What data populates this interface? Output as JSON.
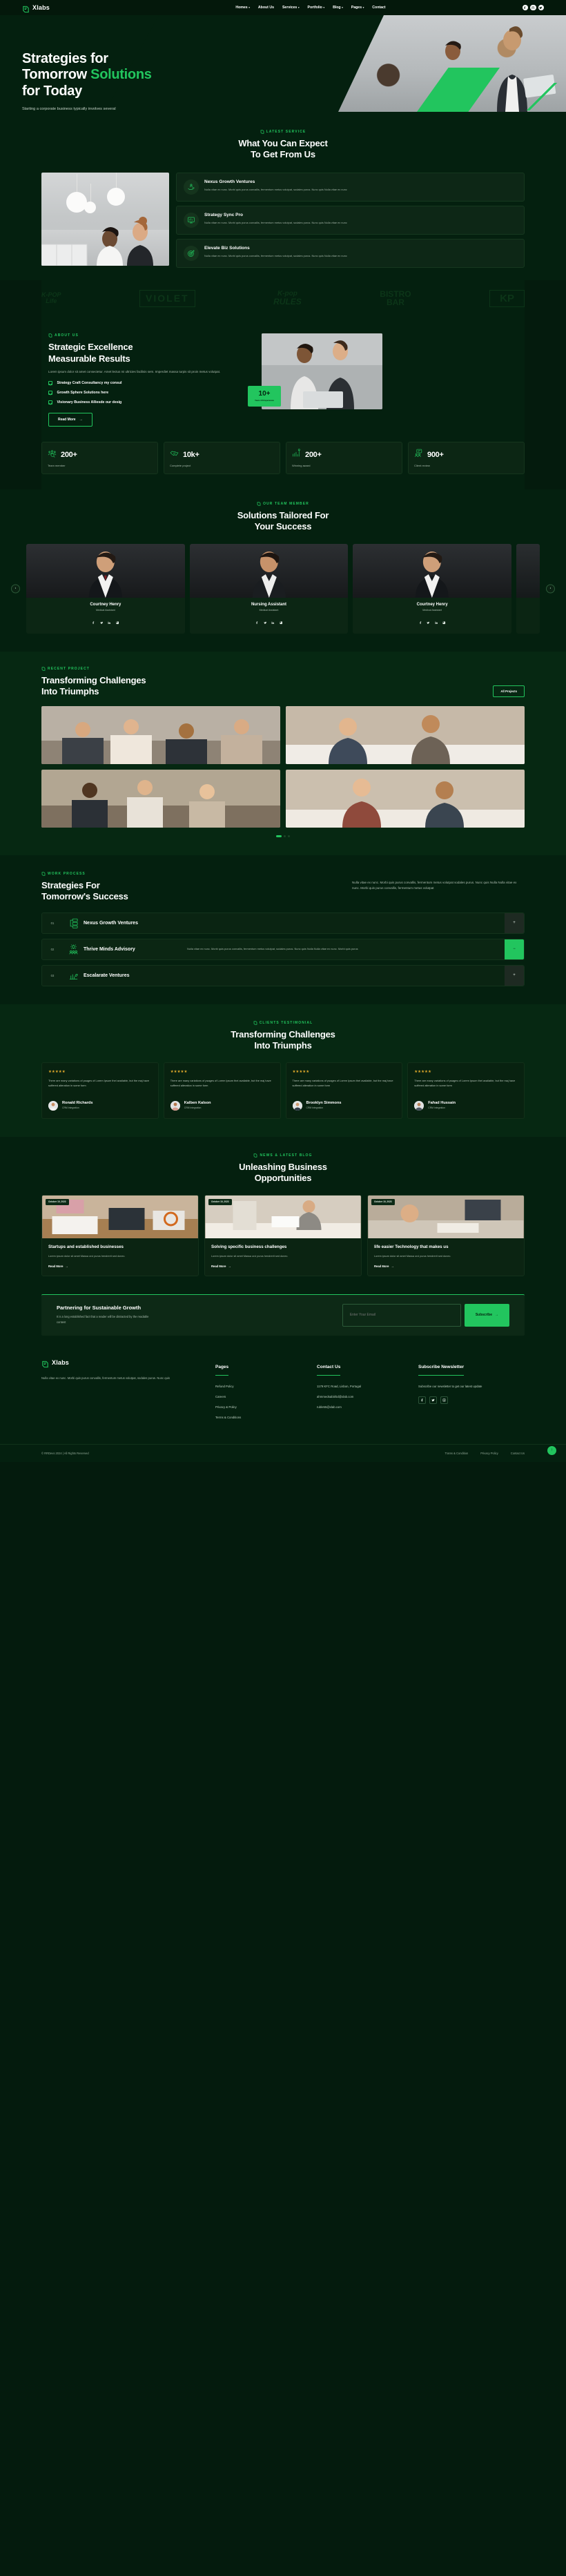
{
  "brand": {
    "name": "Xlabs",
    "logo_icon": "xlabs-logo-icon",
    "accent": "#22c55e",
    "bg": "#04200f"
  },
  "header": {
    "nav": [
      {
        "label": "Homes",
        "caret": "▾"
      },
      {
        "label": "About Us",
        "caret": ""
      },
      {
        "label": "Services",
        "caret": "▾"
      },
      {
        "label": "Portfolio",
        "caret": "▾"
      },
      {
        "label": "Blog",
        "caret": "▾"
      },
      {
        "label": "Pages",
        "caret": "▾"
      },
      {
        "label": "Contact",
        "caret": ""
      }
    ],
    "socials": [
      "facebook-icon",
      "instagram-icon",
      "twitter-icon"
    ]
  },
  "hero": {
    "title_line1": "Strategies for",
    "title_line2a": "Tomorrow ",
    "title_line2b": "Solutions",
    "title_line3": "for Today",
    "subtitle": "Starting a corporate business typically involves several steps, such as decide a business"
  },
  "expect": {
    "eyebrow": "LATEST SERVICE",
    "title_line1": "What You Can Expect",
    "title_line2": "To Get From Us",
    "services": [
      {
        "icon": "hand-person-icon",
        "title": "Nexus Growth Ventures",
        "text": "Nulla vitae ex nunc. Morbi quis purus convallis, fermentum metus volutpat, sodales purus. Nunc quis Nulla vitae ex nunc"
      },
      {
        "icon": "monitor-chart-icon",
        "title": "Strategy Sync Pro",
        "text": "Nulla vitae ex nunc. Morbi quis purus convallis, fermentum metus volutpat, sodales purus. Nunc quis Nulla vitae ex nunc"
      },
      {
        "icon": "target-dart-icon",
        "title": "Elevate Biz Solutions",
        "text": "Nulla vitae ex nunc. Morbi quis purus convallis, fermentum metus volutpat, sodales purus. Nunc quis Nulla vitae ex nunc"
      }
    ]
  },
  "logos": [
    {
      "line1": "K-POP",
      "line2": "Life"
    },
    {
      "line1": "VIOLET",
      "line2": ""
    },
    {
      "line1": "K-pop",
      "line2": "RULES"
    },
    {
      "line1": "BISTRO",
      "line2": "BAR"
    },
    {
      "line1": "KP",
      "line2": ""
    }
  ],
  "about": {
    "eyebrow": "ABOUT US",
    "title_line1": "Strategic Excellence",
    "title_line2": "Measurable Results",
    "text": "Lorem ipsum dolor sit amet consectetur. Amet lectus mi ultricies facilisis sem. Imperdiet massa turpis sit proin metus volutpat.",
    "ticks": [
      "Strategy Craft Consultancy my consul",
      "Growth Sphere Solutions here",
      "Visionary Business Alliesde our desig"
    ],
    "button": "Read More",
    "badge_number": "10+",
    "badge_label": "Years Of Experience"
  },
  "stats": [
    {
      "icon": "team-search-icon",
      "number": "200+",
      "label": "Team member"
    },
    {
      "icon": "handshake-icon",
      "number": "10k+",
      "label": "Complete project"
    },
    {
      "icon": "bar-growth-icon",
      "number": "200+",
      "label": "Winning award"
    },
    {
      "icon": "client-review-icon",
      "number": "900+",
      "label": "Client review"
    }
  ],
  "team": {
    "eyebrow": "OUR TEAM MEMBER",
    "title_line1": "Solutions Tailored For",
    "title_line2": "Your Success",
    "members": [
      {
        "name": "Courtney Henry",
        "role": "Medical Assistant"
      },
      {
        "name": "Nursing Assistant",
        "role": "Medical Assistant"
      },
      {
        "name": "Courtney Henry",
        "role": "Medical Assistant"
      }
    ],
    "socials": [
      "facebook-icon",
      "twitter-icon",
      "linkedin-icon",
      "instagram-icon"
    ],
    "prev": "‹",
    "next": "›"
  },
  "projects": {
    "eyebrow": "RECENT PROJECT",
    "title_line1": "Transforming Challenges",
    "title_line2": "Into Triumphs",
    "button": "All Projects"
  },
  "process": {
    "eyebrow": "WORK PROCESS",
    "title_line1": "Strategies For",
    "title_line2": "Tomorrow's Success",
    "text": "Nulla vitae ex nunc. Morbi quis purus convallis, fermentum metus volutpat sodales purus. Nunc quis Nulla Nulla vitae ex nunc. Morbi quis purus convallis, fermentum metus volutpat",
    "items": [
      {
        "num": "01",
        "icon": "network-nodes-icon",
        "title": "Nexus Growth Ventures",
        "text": "",
        "open": false
      },
      {
        "num": "02",
        "icon": "gear-team-icon",
        "title": "Thrive Minds Advisory",
        "text": "Nulla vitae ex nunc. Morbi quis purus convallis, fermentum metus volutpat, sodales purus. Nunc quis Nulla Nulla vitae ex nunc. Morbi quis purus",
        "open": true
      },
      {
        "num": "03",
        "icon": "hand-growth-icon",
        "title": "Escalarate Ventures",
        "text": "",
        "open": false
      }
    ]
  },
  "testimonials": {
    "eyebrow": "CLIENTS TESTIMONIAL",
    "title_line1": "Transforming Challenges",
    "title_line2": "Into Triumphs",
    "quote": "There are many variations of psages of Lorem Ipsum thei available, but the maj have suffered alteration in some form",
    "stars": 5,
    "items": [
      {
        "name": "Ronald Richards",
        "role": "CRM Integration"
      },
      {
        "name": "Kalben Kalson",
        "role": "CRM Integration"
      },
      {
        "name": "Brooklyn Simmons",
        "role": "CRM Integration"
      },
      {
        "name": "Fahad Hussain",
        "role": "CRM Integration"
      }
    ]
  },
  "blog": {
    "eyebrow": "NEWS & LATEST BLOG",
    "title_line1": "Unleashing Business",
    "title_line2": "Opportunities",
    "posts": [
      {
        "date": "October 19, 2023",
        "title": "Startups and established businesses",
        "text": "Lorem ipsum dolor sit amet Massa orci purus hendrerit sed donec.",
        "link": "Read More"
      },
      {
        "date": "October 19, 2023",
        "title": "Solving specific business challenges",
        "text": "Lorem ipsum dolor sit amet Massa orci purus hendrerit sed donec.",
        "link": "Read More"
      },
      {
        "date": "October 19, 2023",
        "title": "life easier Technology that makes us",
        "text": "Lorem ipsum dolor sit amet Massa orci purus hendrerit sed donec.",
        "link": "Read More"
      }
    ]
  },
  "newsletter": {
    "title": "Partnering for Sustainable Growth",
    "text": "It is a long established fact that a reader will be distracted by the readable content",
    "placeholder": "Enter Your Email",
    "value": "",
    "button": "Subscribe"
  },
  "footer": {
    "about": "Nulla vitae ex nunc. Morbi quis purus convallis, fermentum metus volutpat, sodales purus. Nunc quis",
    "pages_title": "Pages",
    "pages": [
      "Refund Policy",
      "Careers",
      "Privacy & Policy",
      "Terms & Conditions"
    ],
    "contact_title": "Contact Us",
    "contact": [
      "1179 KFC Road, Lisbon, Portugal",
      "ahmmedsabiirbd@xlab.com",
      "ruble55@xlab.com"
    ],
    "subscribe_title": "Subscribe Newsletter",
    "subscribe_text": "Subscribe our newsletter to get our latest update",
    "socials": [
      "facebook-icon",
      "twitter-icon",
      "instagram-icon"
    ],
    "copyright": "© RRDevs 2024 | All Rights Reserved",
    "links": [
      "Trams & Condition",
      "Privacy Policy",
      "Contact Us"
    ],
    "to_top": "↑"
  }
}
